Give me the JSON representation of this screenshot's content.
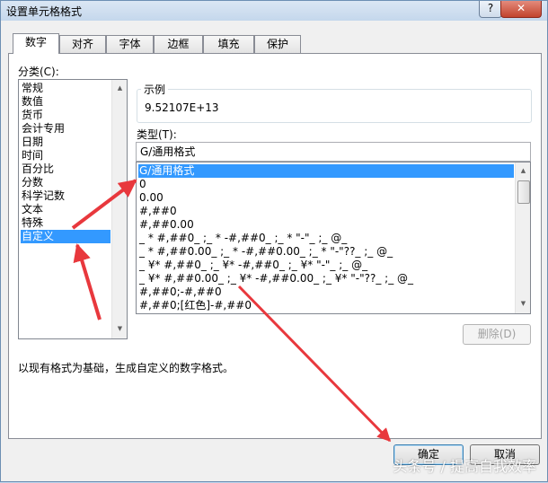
{
  "window": {
    "title": "设置单元格格式",
    "help_label": "?",
    "close_label": "✕"
  },
  "tabs": [
    {
      "label": "数字"
    },
    {
      "label": "对齐"
    },
    {
      "label": "字体"
    },
    {
      "label": "边框"
    },
    {
      "label": "填充"
    },
    {
      "label": "保护"
    }
  ],
  "active_tab": "数字",
  "category": {
    "label": "分类(C):",
    "items": [
      "常规",
      "数值",
      "货币",
      "会计专用",
      "日期",
      "时间",
      "百分比",
      "分数",
      "科学记数",
      "文本",
      "特殊",
      "自定义"
    ],
    "selected": "自定义"
  },
  "sample": {
    "label": "示例",
    "value": "9.52107E+13"
  },
  "type": {
    "label": "类型(T):",
    "value": "G/通用格式",
    "items": [
      "G/通用格式",
      "0",
      "0.00",
      "#,##0",
      "#,##0.00",
      "_ * #,##0_ ;_ * -#,##0_ ;_ * \"-\"_ ;_ @_",
      "_ * #,##0.00_ ;_ * -#,##0.00_ ;_ * \"-\"??_ ;_ @_",
      "_ ¥* #,##0_ ;_ ¥* -#,##0_ ;_ ¥* \"-\"_ ;_ @_",
      "_ ¥* #,##0.00_ ;_ ¥* -#,##0.00_ ;_ ¥* \"-\"??_ ;_ @_",
      "#,##0;-#,##0",
      "#,##0;[红色]-#,##0"
    ],
    "selected": "G/通用格式"
  },
  "delete_label": "删除(D)",
  "description": "以现有格式为基础，生成自定义的数字格式。",
  "ok_label": "确定",
  "cancel_label": "取消",
  "watermark": "头条号 / 提高自我效率",
  "colors": {
    "selection": "#3399ff",
    "annotation_arrow": "#e8383d"
  }
}
